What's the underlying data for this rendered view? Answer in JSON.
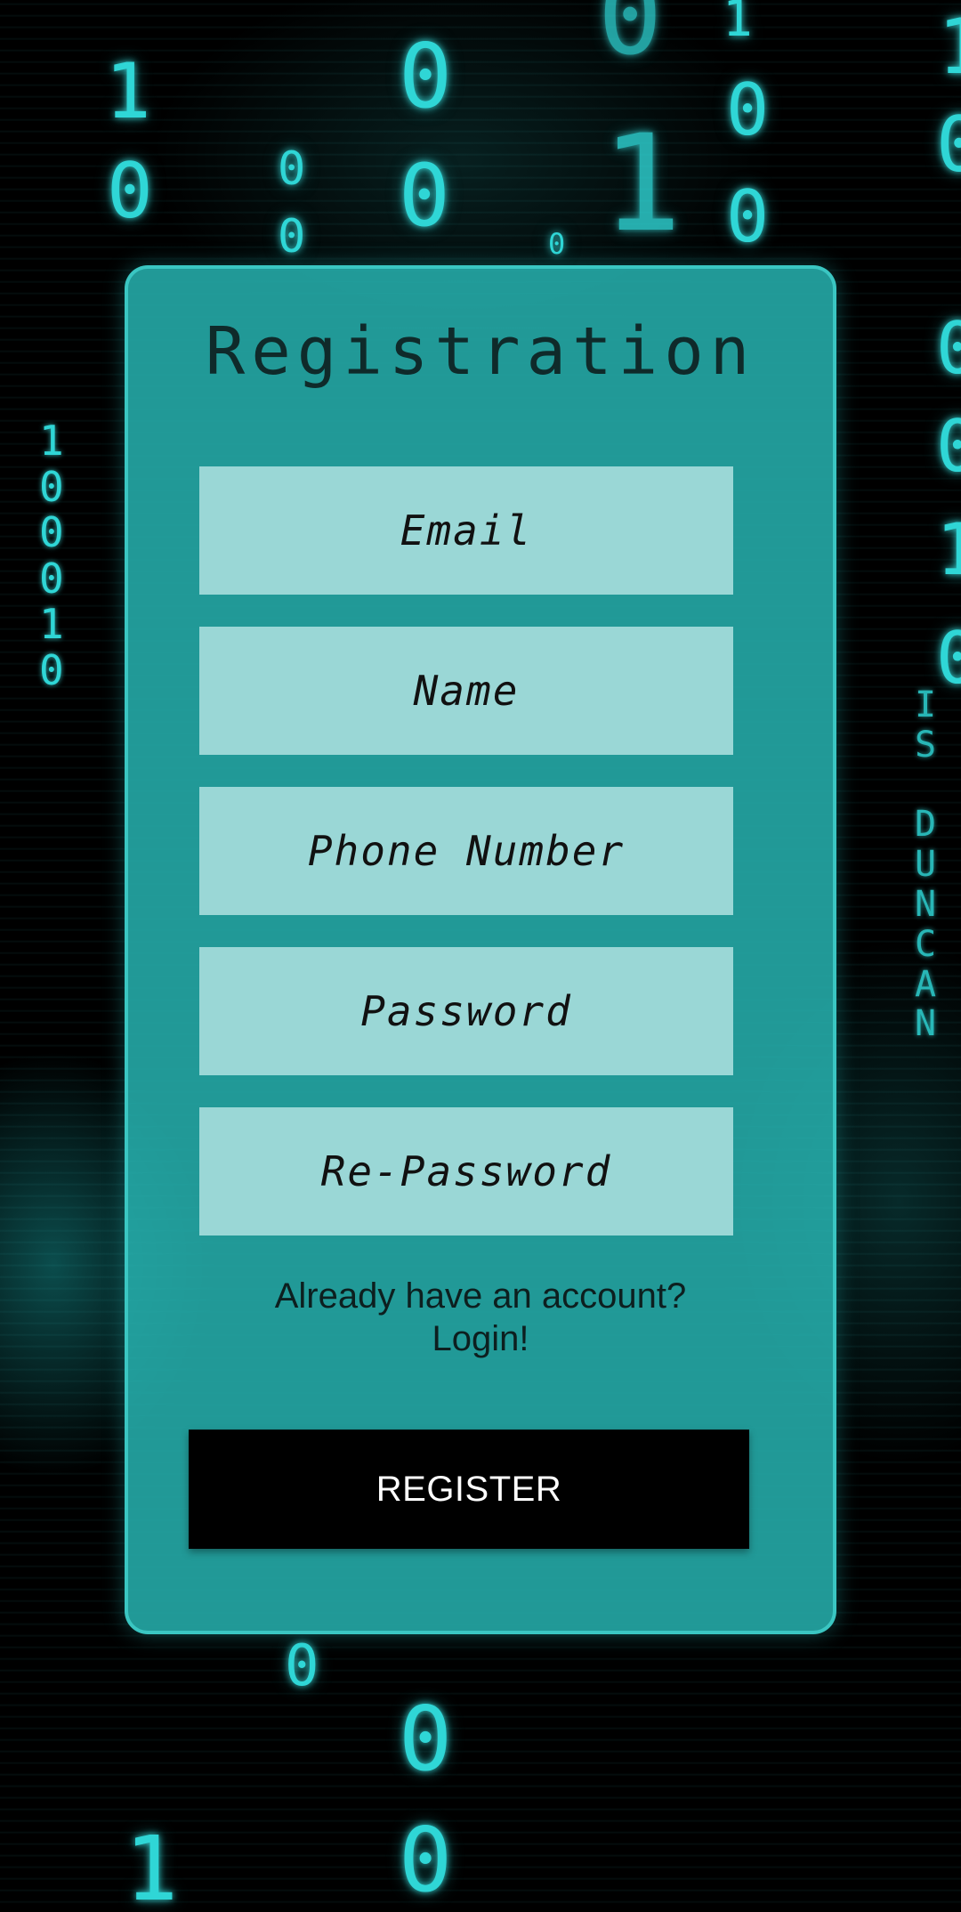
{
  "form": {
    "title": "Registration",
    "fields": [
      {
        "name": "email",
        "placeholder": "Email",
        "value": ""
      },
      {
        "name": "name",
        "placeholder": "Name",
        "value": ""
      },
      {
        "name": "phone",
        "placeholder": "Phone Number",
        "value": ""
      },
      {
        "name": "password",
        "placeholder": "Password",
        "value": ""
      },
      {
        "name": "repassword",
        "placeholder": "Re-Password",
        "value": ""
      }
    ],
    "login_prompt_line1": "Already have an account?",
    "login_prompt_line2": "Login!",
    "register_label": "REGISTER"
  },
  "background": {
    "side_column_digits": "1\n0\n0\n0\n1\n0",
    "side_column_letters": "I\nS\n\nD\nU\nN\nC\nA\nN"
  },
  "colors": {
    "card": "#26b2b0",
    "field": "#bce8e8",
    "glow": "#2fd6d6",
    "button": "#000000"
  }
}
